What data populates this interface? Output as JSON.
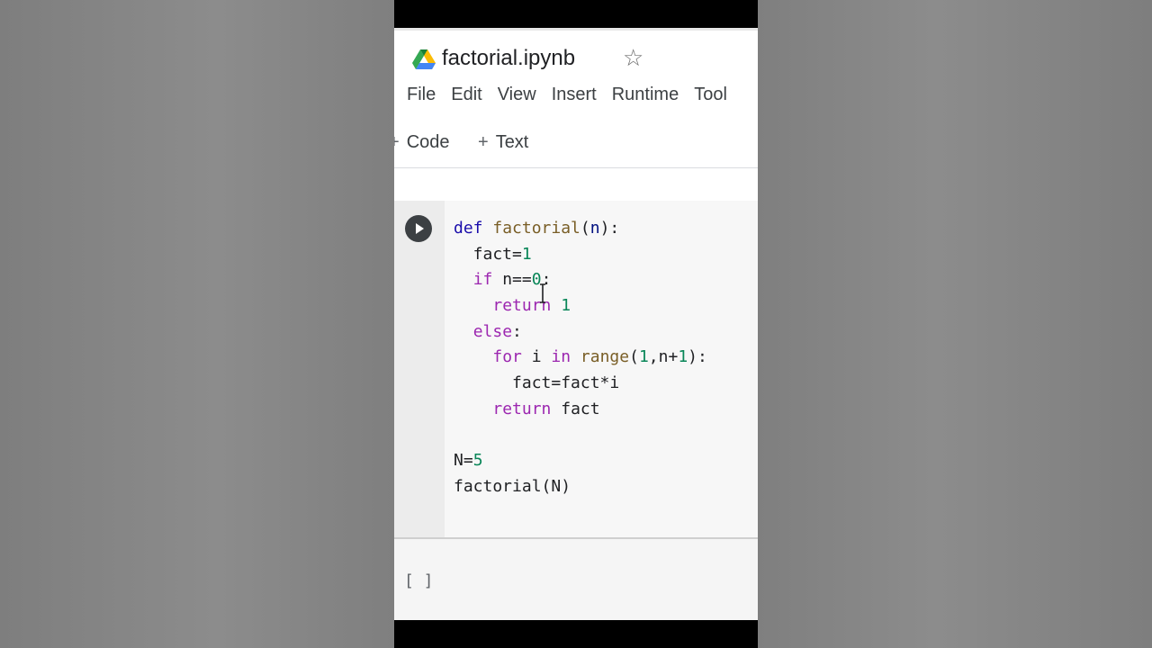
{
  "notebook": {
    "title": "factorial.ipynb",
    "app_icon": "google-drive-icon",
    "star_icon": "star-outline-icon"
  },
  "menu": {
    "items": [
      "File",
      "Edit",
      "View",
      "Insert",
      "Runtime",
      "Tool"
    ]
  },
  "toolbar": {
    "code_label": "Code",
    "text_label": "Text",
    "plus_symbol": "+"
  },
  "cell": {
    "run_icon": "play-icon",
    "code_lines": [
      "def factorial(n):",
      "  fact=1",
      "  if n==0:",
      "    return 1",
      "  else:",
      "    for i in range(1,n+1):",
      "      fact=fact*i",
      "    return fact",
      "",
      "N=5",
      "factorial(N)"
    ]
  },
  "output": {
    "prompt": "[ ]"
  },
  "colors": {
    "keyword": "#9c27b0",
    "def_keyword": "#1a0dab",
    "function_name": "#795e26",
    "number": "#098658"
  }
}
